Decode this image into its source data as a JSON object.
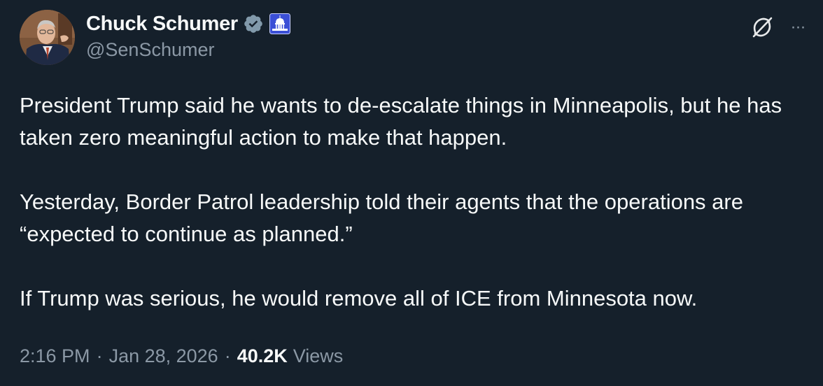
{
  "author": {
    "display_name": "Chuck Schumer",
    "handle": "@SenSchumer",
    "verified_icon": "verified-badge-icon",
    "affiliation_icon": "capitol-icon",
    "avatar": "avatar-photo"
  },
  "actions": {
    "grok_icon": "grok-icon",
    "more_label": "···"
  },
  "tweet": {
    "paragraphs": [
      "President Trump said he wants to de-escalate things in Minneapolis, but he has taken zero meaningful action to make that happen.",
      "Yesterday, Border Patrol leadership told their agents that the operations are “expected to continue as planned.”",
      "If Trump was serious, he would remove all of ICE from Minnesota now."
    ]
  },
  "meta": {
    "time": "2:16 PM",
    "separator": "·",
    "date": "Jan 28, 2026",
    "views_count": "40.2K",
    "views_label": "Views"
  },
  "colors": {
    "background": "#15202b",
    "text": "#f7f9f9",
    "secondary": "#8b98a5",
    "verified_badge": "#829aab",
    "affiliation_bg": "#3b4fd6"
  }
}
